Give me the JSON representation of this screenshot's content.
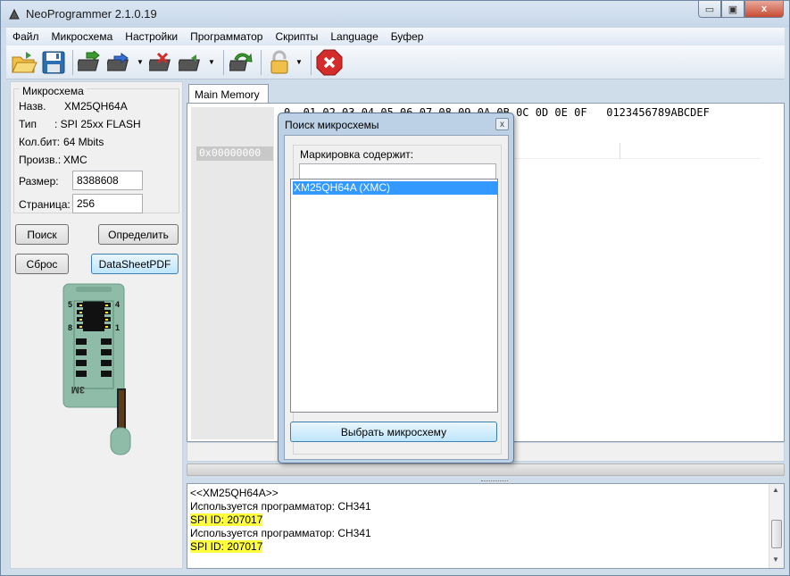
{
  "window": {
    "title": "NeoProgrammer 2.1.0.19",
    "minimize_symbol": "▭",
    "maximize_symbol": "▣",
    "close_symbol": "x"
  },
  "menu": [
    "Файл",
    "Микросхема",
    "Настройки",
    "Программатор",
    "Скрипты",
    "Language",
    "Буфер"
  ],
  "toolbar": {
    "icons": [
      "open-folder-icon",
      "save-floppy-icon",
      "read-chip-icon",
      "write-chip-icon",
      "erase-chip-icon",
      "verify-chip-icon",
      "auto-cycle-icon",
      "lock-icon",
      "stop-icon"
    ],
    "accent_colors": {
      "open": "#e8a520",
      "save": "#2c6fb0",
      "stop": "#d42b2b",
      "chip_green": "#3d9a32"
    }
  },
  "chip_info": {
    "group_title": "Микросхема",
    "name_label": "Назв.",
    "name_value": "XM25QH64A",
    "type_label": "Тип",
    "type_value": ": SPI 25xx FLASH",
    "bits_label": "Кол.бит:",
    "bits_value": "64 Mbits",
    "vendor_label": "Произв.:",
    "vendor_value": "XMC",
    "size_label": "Размер:",
    "size_value": "8388608",
    "page_label": "Страница:",
    "page_value": "256"
  },
  "buttons": {
    "search": "Поиск",
    "detect": "Определить",
    "reset": "Сброс",
    "datasheet": "DataSheetPDF"
  },
  "socket": {
    "pin_left_top": "5",
    "pin_left_bottom": "8",
    "pin_right_top": "4",
    "pin_right_bottom": "1",
    "board_label": "3M"
  },
  "tabs": {
    "main_memory": "Main Memory"
  },
  "hex": {
    "header": "0  01 02 03 04 05 06 07 08 09 0A 0B 0C 0D 0E 0F   0123456789ABCDEF",
    "address": "0x00000000"
  },
  "log": [
    {
      "text": "<<XM25QH64A>>",
      "highlight": false
    },
    {
      "text": "Используется программатор: CH341",
      "highlight": false
    },
    {
      "text": "SPI ID: 207017",
      "highlight": true
    },
    {
      "text": "Используется программатор: CH341",
      "highlight": false
    },
    {
      "text": "SPI ID: 207017",
      "highlight": true
    }
  ],
  "dialog": {
    "title": "Поиск микросхемы",
    "close_symbol": "x",
    "filter_label": "Маркировка содержит:",
    "filter_value": "",
    "results": [
      "XM25QH64A (XMC)"
    ],
    "select_button": "Выбрать микросхему"
  }
}
